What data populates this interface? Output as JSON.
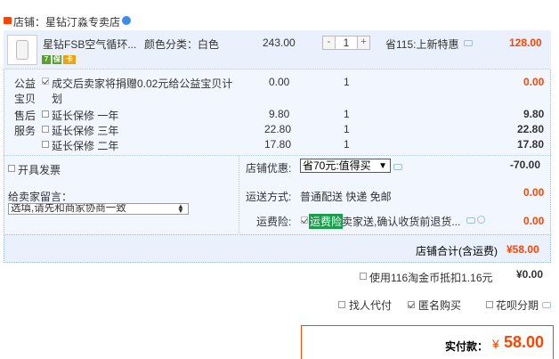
{
  "shop": {
    "label": "店铺：",
    "name": "星钻汀淼专卖店"
  },
  "item": {
    "title": "星钻FSB空气循环...",
    "color_label": "颜色分类：",
    "color_value": "白色",
    "price": "243.00",
    "qty": "1",
    "qty_minus": "-",
    "qty_plus": "+",
    "promo": "省115:上新特惠",
    "subtotal": "128.00",
    "badges": [
      "7",
      "保",
      "卡"
    ]
  },
  "charity": {
    "label_a": "公益",
    "label_b": "宝贝",
    "text_a": "成交后卖家将捐赠0.02元给公益宝贝计",
    "text_b": "划",
    "price": "0.00",
    "qty": "1",
    "subtotal": "0.00"
  },
  "warranty": {
    "label_a": "售后",
    "label_b": "服务",
    "options": [
      {
        "label": "延长保修 一年",
        "price": "9.80",
        "qty": "1",
        "subtotal": "9.80"
      },
      {
        "label": "延长保修 三年",
        "price": "22.80",
        "qty": "1",
        "subtotal": "22.80"
      },
      {
        "label": "延长保修 二年",
        "price": "17.80",
        "qty": "1",
        "subtotal": "17.80"
      }
    ]
  },
  "invoice": {
    "label": "开具发票"
  },
  "shop_discount": {
    "label": "店铺优惠:",
    "selected": "省70元:值得买",
    "value": "-70.00"
  },
  "message": {
    "label": "给卖家留言：",
    "placeholder": "选填,请先和商家协商一致"
  },
  "shipping": {
    "label": "运送方式:",
    "value": "普通配送 快递 免邮",
    "price": "0.00"
  },
  "insurance": {
    "label": "运费险:",
    "tag": "运费险",
    "text": "卖家送,确认收货前退货...",
    "price": "0.00"
  },
  "shop_total": {
    "label": "店铺合计(含运费)",
    "value": "¥58.00"
  },
  "coins": {
    "label": "使用116淘金币抵扣1.16元",
    "value": "¥0.00"
  },
  "options": {
    "proxy_pay": "找人代付",
    "anonymous": "匿名购买",
    "huabei": "花呗分期"
  },
  "payment": {
    "label": "实付款：",
    "currency": "¥",
    "value": "58.00"
  },
  "colors": {
    "accent": "#ff4400",
    "panel": "#f2f7ff",
    "border": "#9cb6d8"
  }
}
